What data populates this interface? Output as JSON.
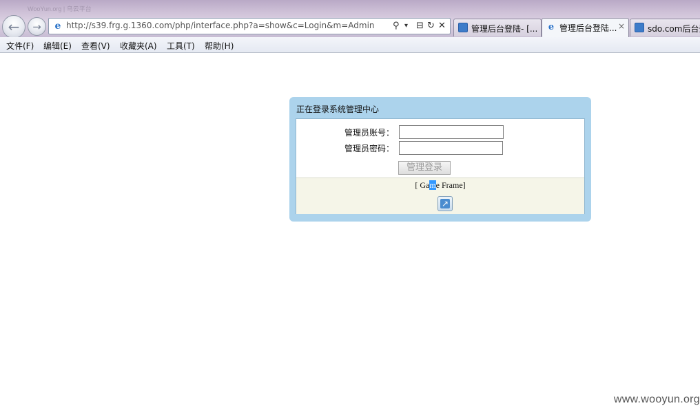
{
  "browser": {
    "faded_title": "WooYun.org | 乌云平台",
    "url": "http://s39.frg.g.1360.com/php/interface.php?a=show&c=Login&m=Admin",
    "tabs": [
      {
        "label": "管理后台登陆- [...",
        "icon": "search-icon",
        "active": false
      },
      {
        "label": "管理后台登陆...",
        "icon": "ie-icon",
        "active": true,
        "close": "×"
      },
      {
        "label": "sdo.com后台登",
        "icon": "search-icon",
        "active": false
      }
    ],
    "controls": {
      "search": "⚲",
      "dropdown": "▾",
      "compat": "⊟",
      "refresh": "↻",
      "stop": "✕"
    }
  },
  "menubar": {
    "items": [
      "文件(F)",
      "编辑(E)",
      "查看(V)",
      "收藏夹(A)",
      "工具(T)",
      "帮助(H)"
    ]
  },
  "login": {
    "title": "正在登录系统管理中心",
    "username_label": "管理员账号：",
    "password_label": "管理员密码：",
    "username_value": "",
    "password_value": "",
    "submit_label": "管理登录",
    "game_frame": {
      "prefix": "[ Ga",
      "selected": "m",
      "suffix": "e Frame]"
    }
  },
  "watermark": "www.wooyun.org",
  "colors": {
    "panel_bg": "#acd3ec",
    "footer_bg": "#f5f5e8",
    "titlebar": "#cdbfd6"
  }
}
